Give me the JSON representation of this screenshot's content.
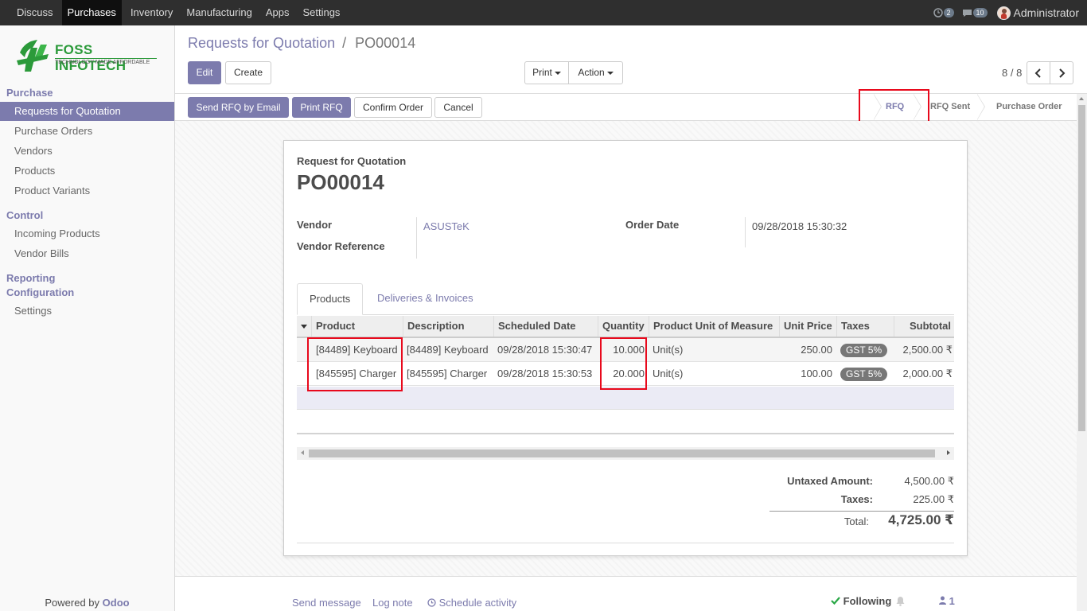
{
  "topbar": {
    "menu": [
      "Discuss",
      "Purchases",
      "Inventory",
      "Manufacturing",
      "Apps",
      "Settings"
    ],
    "activity_count": "2",
    "message_count": "10",
    "user": "Administrator"
  },
  "brand": {
    "name": "FOSS INFOTECH",
    "tagline": "TECHNOLOGY MADE AFFORDABLE",
    "color": "#2b9a3a"
  },
  "sidebar": {
    "section_purchase": "Purchase",
    "purchase_items": [
      "Requests for Quotation",
      "Purchase Orders",
      "Vendors",
      "Products",
      "Product Variants"
    ],
    "section_control": "Control",
    "control_items": [
      "Incoming Products",
      "Vendor Bills"
    ],
    "section_reporting": "Reporting",
    "section_configuration": "Configuration",
    "configuration_items": [
      "Settings"
    ],
    "powered_by": "Powered by",
    "powered_brand": "Odoo"
  },
  "breadcrumb": {
    "parent": "Requests for Quotation",
    "separator": "/",
    "current": "PO00014"
  },
  "buttons": {
    "edit": "Edit",
    "create": "Create",
    "print": "Print",
    "action": "Action",
    "send_rfq": "Send RFQ by Email",
    "print_rfq": "Print RFQ",
    "confirm": "Confirm Order",
    "cancel": "Cancel"
  },
  "pager": {
    "text": "8 / 8"
  },
  "status_stages": [
    "RFQ",
    "RFQ Sent",
    "Purchase Order"
  ],
  "form": {
    "doc_type": "Request for Quotation",
    "number": "PO00014",
    "vendor_label": "Vendor",
    "vendor_value": "ASUSTeK",
    "vendor_ref_label": "Vendor Reference",
    "order_date_label": "Order Date",
    "order_date_value": "09/28/2018 15:30:32"
  },
  "tabs": [
    "Products",
    "Deliveries & Invoices"
  ],
  "lines": {
    "headers": [
      "Product",
      "Description",
      "Scheduled Date",
      "Quantity",
      "Product Unit of Measure",
      "Unit Price",
      "Taxes",
      "Subtotal"
    ],
    "rows": [
      {
        "product": "[84489] Keyboard",
        "description": "[84489] Keyboard",
        "date": "09/28/2018 15:30:47",
        "qty": "10.000",
        "uom": "Unit(s)",
        "price": "250.00",
        "tax": "GST 5%",
        "subtotal": "2,500.00 ₹"
      },
      {
        "product": "[845595] Charger",
        "description": "[845595] Charger",
        "date": "09/28/2018 15:30:53",
        "qty": "20.000",
        "uom": "Unit(s)",
        "price": "100.00",
        "tax": "GST 5%",
        "subtotal": "2,000.00 ₹"
      }
    ]
  },
  "totals": {
    "untaxed_label": "Untaxed Amount:",
    "untaxed_value": "4,500.00 ₹",
    "taxes_label": "Taxes:",
    "taxes_value": "225.00 ₹",
    "total_label": "Total:",
    "total_value": "4,725.00 ₹"
  },
  "chatter": {
    "send_message": "Send message",
    "log_note": "Log note",
    "schedule_activity": "Schedule activity",
    "following": "Following",
    "followers": "1"
  },
  "colors": {
    "accent": "#7c7bad",
    "highlight": "#e8091c"
  }
}
